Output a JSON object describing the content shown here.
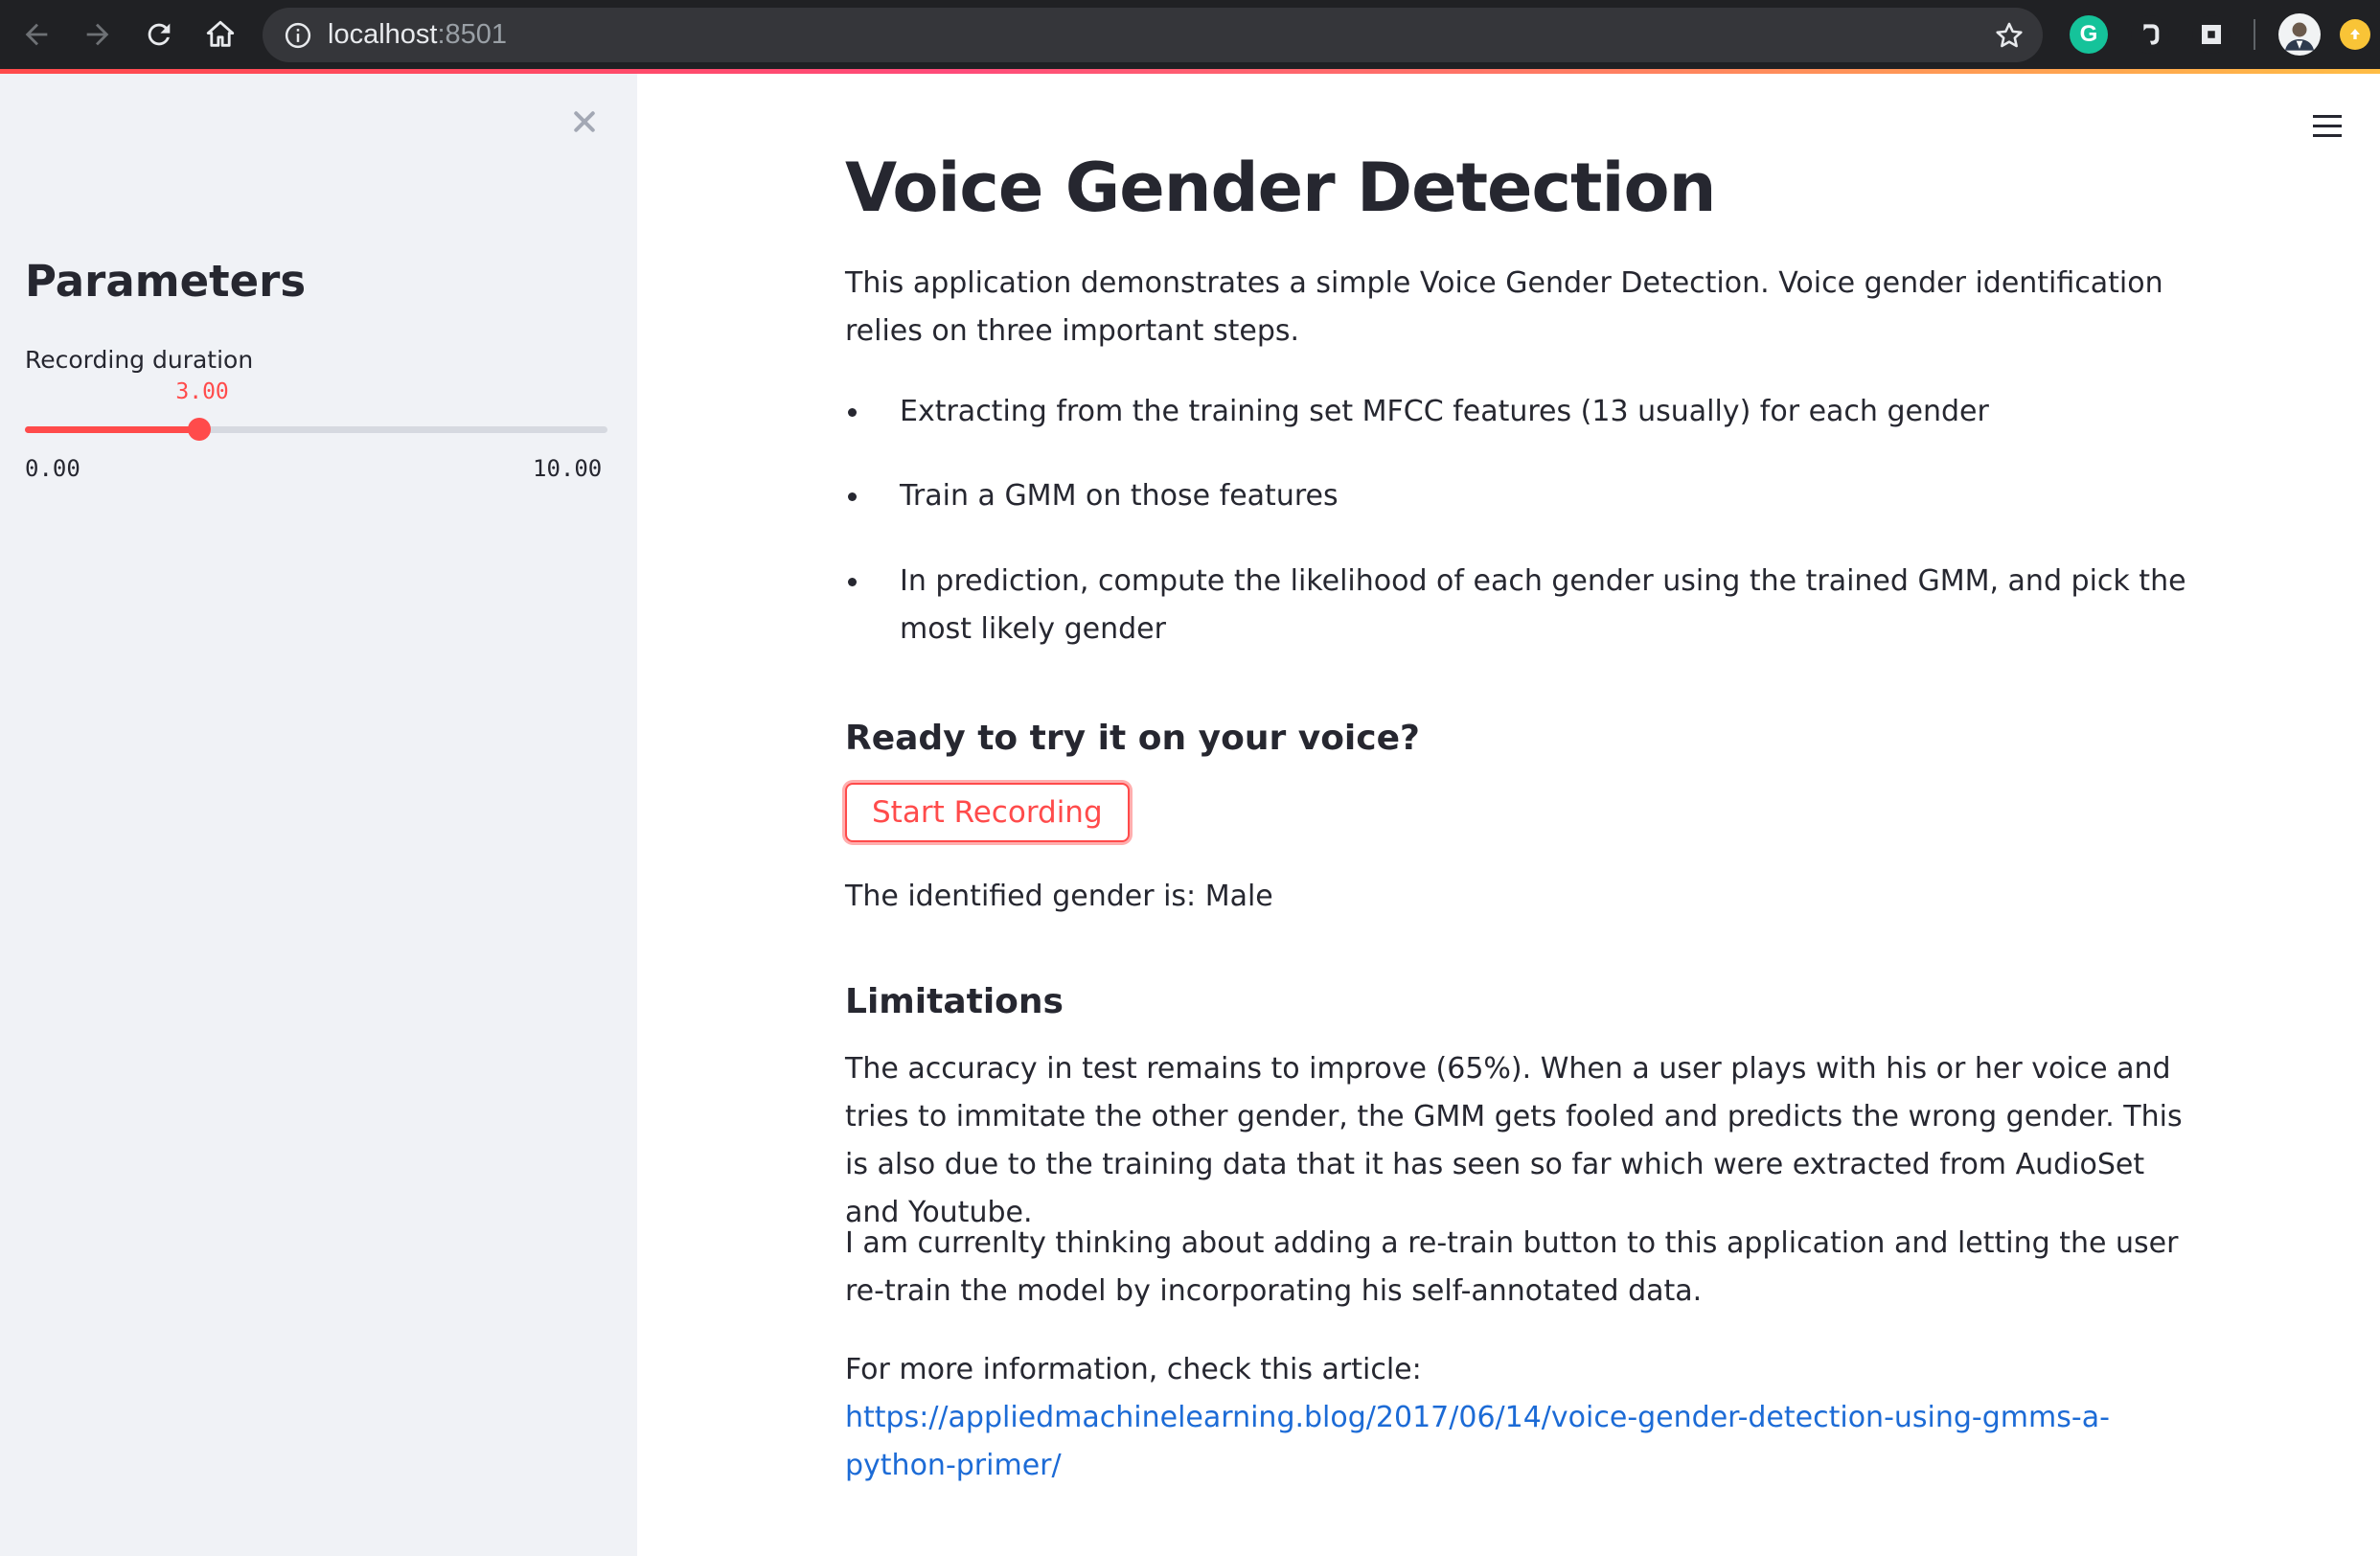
{
  "browser": {
    "url_host": "localhost",
    "url_port": ":8501",
    "accent_colors": [
      "#ff4b4b",
      "#ffbd45"
    ]
  },
  "sidebar": {
    "title": "Parameters",
    "slider": {
      "label": "Recording duration",
      "value_text": "3.00",
      "value": 3.0,
      "min_text": "0.00",
      "max_text": "10.00",
      "min": 0,
      "max": 10,
      "color": "#ff4b4b"
    }
  },
  "main": {
    "title": "Voice Gender Detection",
    "intro": "This application demonstrates a simple Voice Gender Detection. Voice gender identification relies on three important steps.",
    "bullets": [
      "Extracting from the training set MFCC features (13 usually) for each gender",
      "Train a GMM on those features",
      "In prediction, compute the likelihood of each gender using the trained GMM, and pick the most likely gender"
    ],
    "try_heading": "Ready to try it on your voice?",
    "record_button": "Start Recording",
    "result_text": "The identified gender is: Male",
    "limitations_heading": "Limitations",
    "limitations_p1": "The accuracy in test remains to improve (65%). When a user plays with his or her voice and tries to immitate the other gender, the GMM gets fooled and predicts the wrong gender. This is also due to the training data that it has seen so far which were extracted from AudioSet and Youtube.",
    "limitations_p2": "I am currenlty thinking about adding a re-train button to this application and letting the user re-train the model by incorporating his self-annotated data.",
    "more_info_prefix": "For more information, check this article: ",
    "article_link": "https://appliedmachinelearning.blog/2017/06/14/voice-gender-detection-using-gmms-a-python-primer/",
    "link_color": "#1c6bd6"
  }
}
